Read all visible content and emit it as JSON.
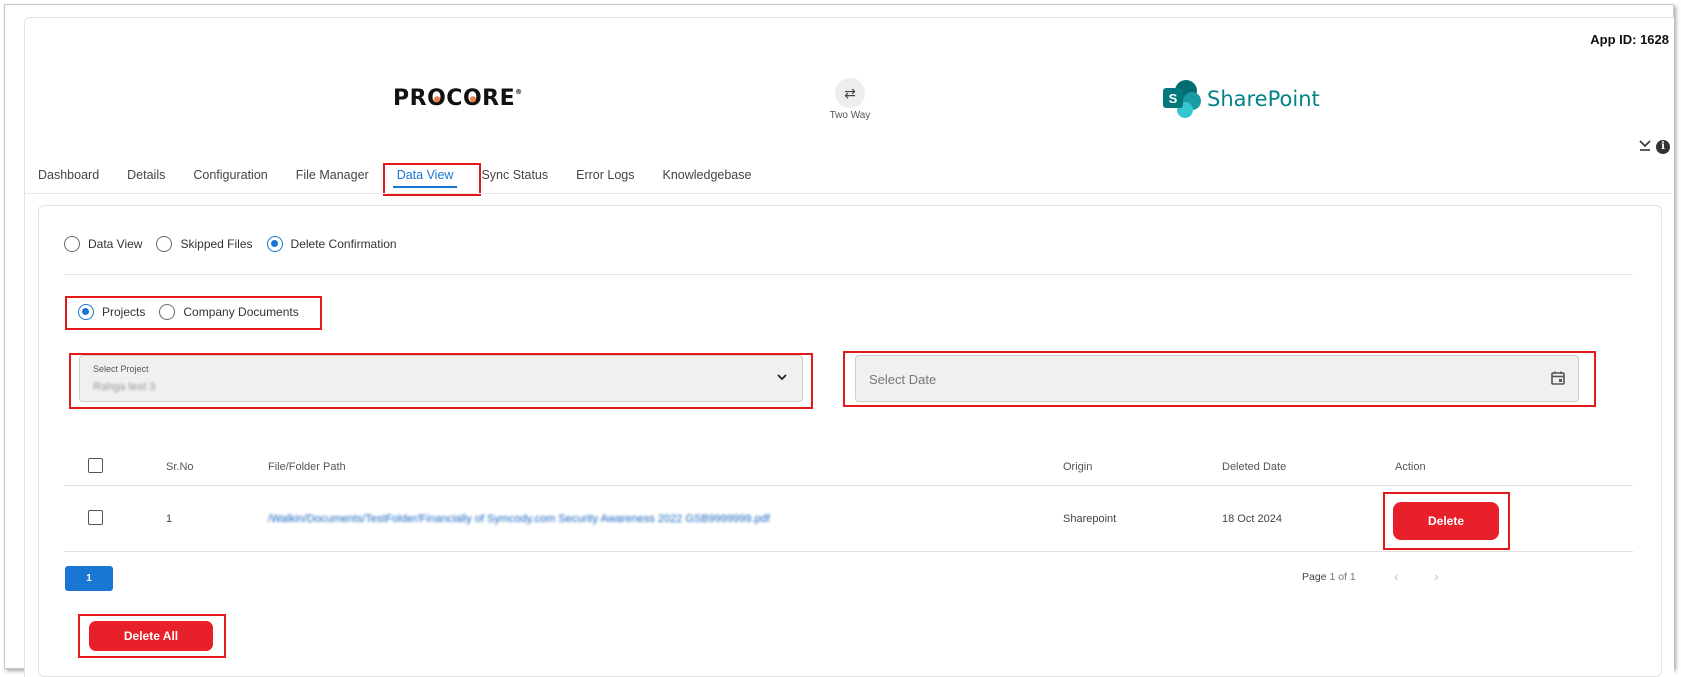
{
  "header": {
    "app_id": "App ID: 1628",
    "procore_logo_text": "PROCORE",
    "sync_label": "Two Way",
    "sync_icon": "swap-arrows-icon",
    "sharepoint_letter": "S",
    "sharepoint_text": "SharePoint"
  },
  "tabs": [
    {
      "label": "Dashboard"
    },
    {
      "label": "Details"
    },
    {
      "label": "Configuration"
    },
    {
      "label": "File Manager"
    },
    {
      "label": "Data View",
      "active": true
    },
    {
      "label": "Sync Status"
    },
    {
      "label": "Error Logs"
    },
    {
      "label": "Knowledgebase"
    }
  ],
  "view_options": [
    {
      "label": "Data View",
      "checked": false
    },
    {
      "label": "Skipped Files",
      "checked": false
    },
    {
      "label": "Delete Confirmation",
      "checked": true
    }
  ],
  "scope_options": [
    {
      "label": "Projects",
      "checked": true
    },
    {
      "label": "Company Documents",
      "checked": false
    }
  ],
  "filters": {
    "project_label": "Select Project",
    "project_value": "Rahga test 3",
    "date_placeholder": "Select Date"
  },
  "table": {
    "headers": [
      "Sr.No",
      "File/Folder Path",
      "Origin",
      "Deleted Date",
      "Action"
    ],
    "rows": [
      {
        "sr_no": "1",
        "path": "/Walkin/Documents/TestFolder/Financially of Symcody.com Security Awareness 2022 GSB9999999.pdf",
        "origin": "Sharepoint",
        "deleted_date": "18 Oct 2024",
        "action_label": "Delete"
      }
    ]
  },
  "pagination": {
    "current_page": "1",
    "info_prefix": "Page ",
    "info_value": "1 of 1"
  },
  "delete_all_label": "Delete All",
  "colors": {
    "accent": "#1976d2",
    "danger": "#e8202a",
    "highlight": "#e21a1a",
    "sharepoint": "#038387"
  }
}
